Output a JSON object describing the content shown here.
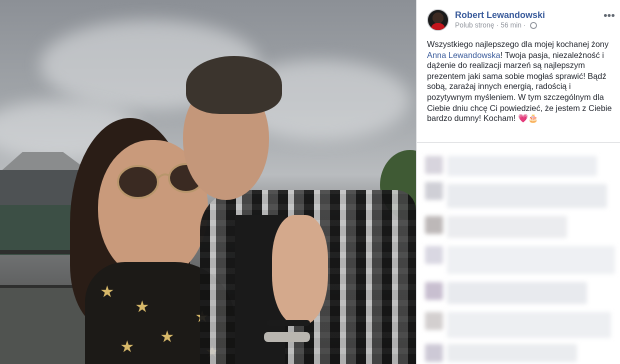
{
  "post": {
    "author": "Robert Lewandowski",
    "follow_label": "Polub stronę",
    "separator": "·",
    "time": "56 min",
    "more_icon": "more-dots-icon",
    "text_before_mention": "Wszystkiego najlepszego dla mojej kochanej żony ",
    "mention": "Anna Lewandowska",
    "text_after_mention": "! Twoja pasja, niezależność i dążenie do realizacji marzeń są najlepszym prezentem jaki sama sobie mogłaś sprawić! Bądź sobą, zarażaj innych energią, radością i pozytywnym myśleniem. W tym szczególnym dla Ciebie dniu chcę Ci powiedzieć, że jestem z Ciebie bardzo dumny! Kocham! ",
    "emoji_heart": "💗",
    "emoji_cake": "🎂"
  },
  "colors": {
    "link": "#365899",
    "meta": "#90949c",
    "text": "#1d2129"
  }
}
